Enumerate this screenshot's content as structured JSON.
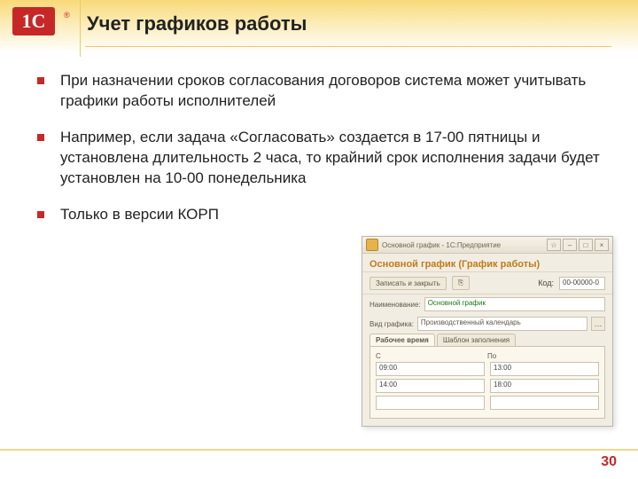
{
  "logo_text": "1C",
  "title": "Учет графиков работы",
  "bullets": [
    "При назначении сроков согласования договоров система может учитывать графики работы исполнителей",
    "Например, если задача «Согласовать» создается в 17-00 пятницы и установлена длительность 2 часа, то крайний срок исполнения задачи будет установлен на 10-00 понедельника",
    "Только в версии КОРП"
  ],
  "app": {
    "window_title": "Основной график - 1С:Предприятие",
    "header": "Основной график (График работы)",
    "btn_save_close": "Записать и закрыть",
    "code_label": "Код:",
    "code_value": "00-00000-0",
    "name_label": "Наименование:",
    "name_value": "Основной график",
    "vid_label": "Вид графика:",
    "vid_value": "Производственный календарь",
    "tab_work": "Рабочее время",
    "tab_break": "Шаблон заполнения",
    "col_from": "С",
    "col_to": "По",
    "rows": [
      {
        "from": "09:00",
        "to": "13:00"
      },
      {
        "from": "14:00",
        "to": "18:00"
      },
      {
        "from": "",
        "to": ""
      }
    ]
  },
  "page_number": "30"
}
